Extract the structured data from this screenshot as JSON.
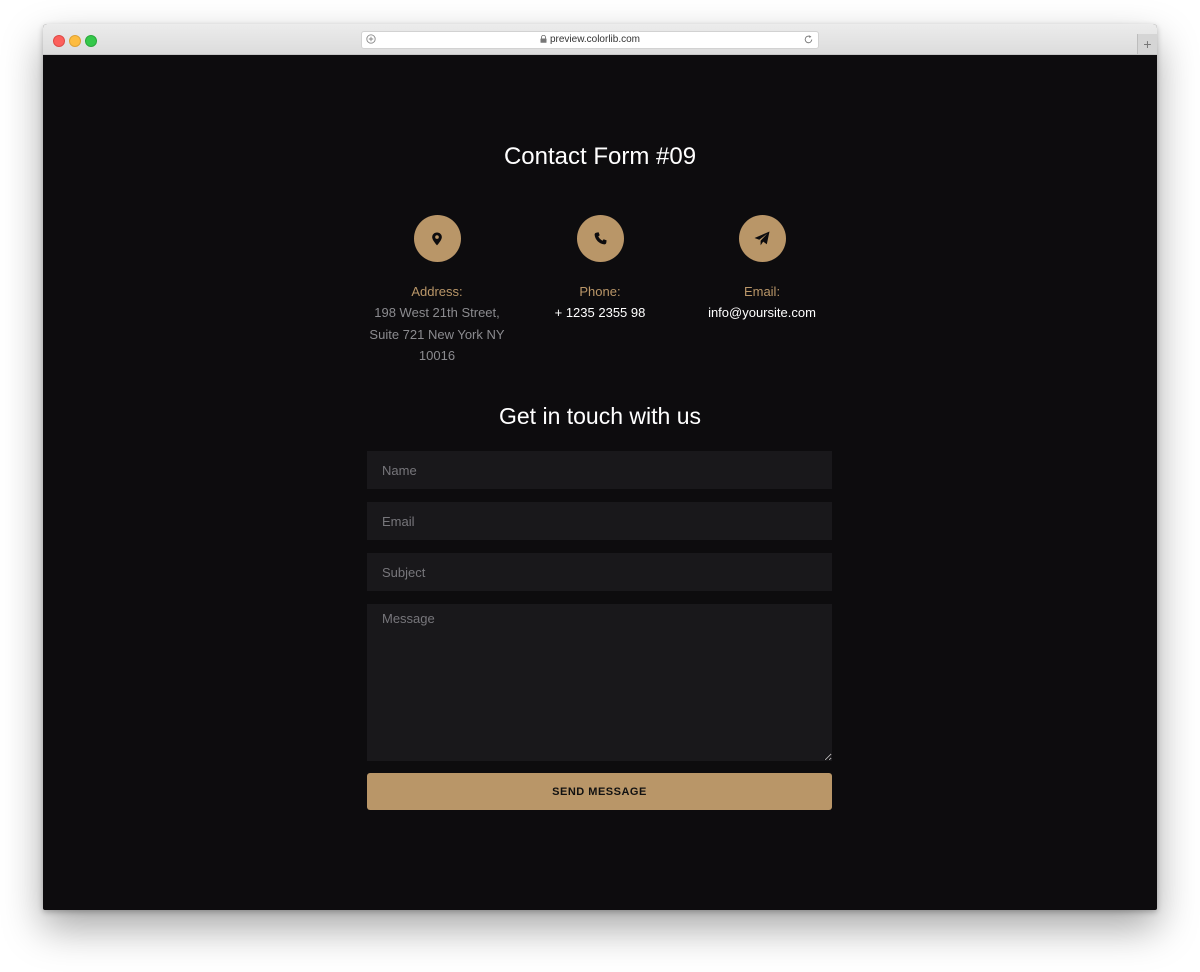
{
  "browser": {
    "url": "preview.colorlib.com",
    "new_tab_label": "+"
  },
  "page": {
    "title": "Contact Form #09",
    "accent_color": "#b99668",
    "background_color": "#0d0c0e"
  },
  "contact_info": {
    "address": {
      "icon": "map-pin-icon",
      "label": "Address:",
      "lines": [
        "198 West 21th Street,",
        "Suite 721 New York NY",
        "10016"
      ]
    },
    "phone": {
      "icon": "phone-icon",
      "label": "Phone:",
      "value": "+ 1235 2355 98"
    },
    "email": {
      "icon": "paper-plane-icon",
      "label": "Email:",
      "value": "info@yoursite.com"
    }
  },
  "form": {
    "heading": "Get in touch with us",
    "name_placeholder": "Name",
    "email_placeholder": "Email",
    "subject_placeholder": "Subject",
    "message_placeholder": "Message",
    "submit_label": "SEND MESSAGE"
  }
}
